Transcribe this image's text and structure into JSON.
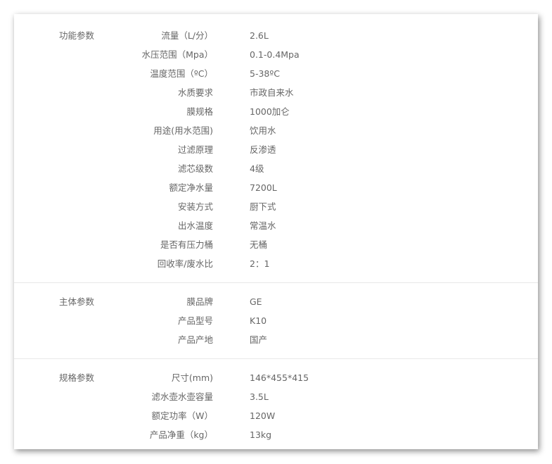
{
  "sections": [
    {
      "title": "功能参数",
      "rows": [
        {
          "k": "流量（L/分）",
          "v": "2.6L"
        },
        {
          "k": "水压范围（Mpa）",
          "v": "0.1-0.4Mpa"
        },
        {
          "k": "温度范围（ºC）",
          "v": "5-38ºC"
        },
        {
          "k": "水质要求",
          "v": "市政自来水"
        },
        {
          "k": "膜规格",
          "v": "1000加仑"
        },
        {
          "k": "用途(用水范围)",
          "v": "饮用水"
        },
        {
          "k": "过滤原理",
          "v": "反渗透"
        },
        {
          "k": "滤芯级数",
          "v": "4级"
        },
        {
          "k": "额定净水量",
          "v": "7200L"
        },
        {
          "k": "安装方式",
          "v": "厨下式"
        },
        {
          "k": "出水温度",
          "v": "常温水"
        },
        {
          "k": "是否有压力桶",
          "v": "无桶"
        },
        {
          "k": "回收率/废水比",
          "v": "2：1"
        }
      ]
    },
    {
      "title": "主体参数",
      "rows": [
        {
          "k": "膜品牌",
          "v": "GE"
        },
        {
          "k": "产品型号",
          "v": "K10"
        },
        {
          "k": "产品产地",
          "v": "国产"
        }
      ]
    },
    {
      "title": "规格参数",
      "rows": [
        {
          "k": "尺寸(mm)",
          "v": "146*455*415"
        },
        {
          "k": "滤水壶水壶容量",
          "v": "3.5L"
        },
        {
          "k": "额定功率（W）",
          "v": "120W"
        },
        {
          "k": "产品净重（kg）",
          "v": "13kg"
        }
      ]
    }
  ]
}
